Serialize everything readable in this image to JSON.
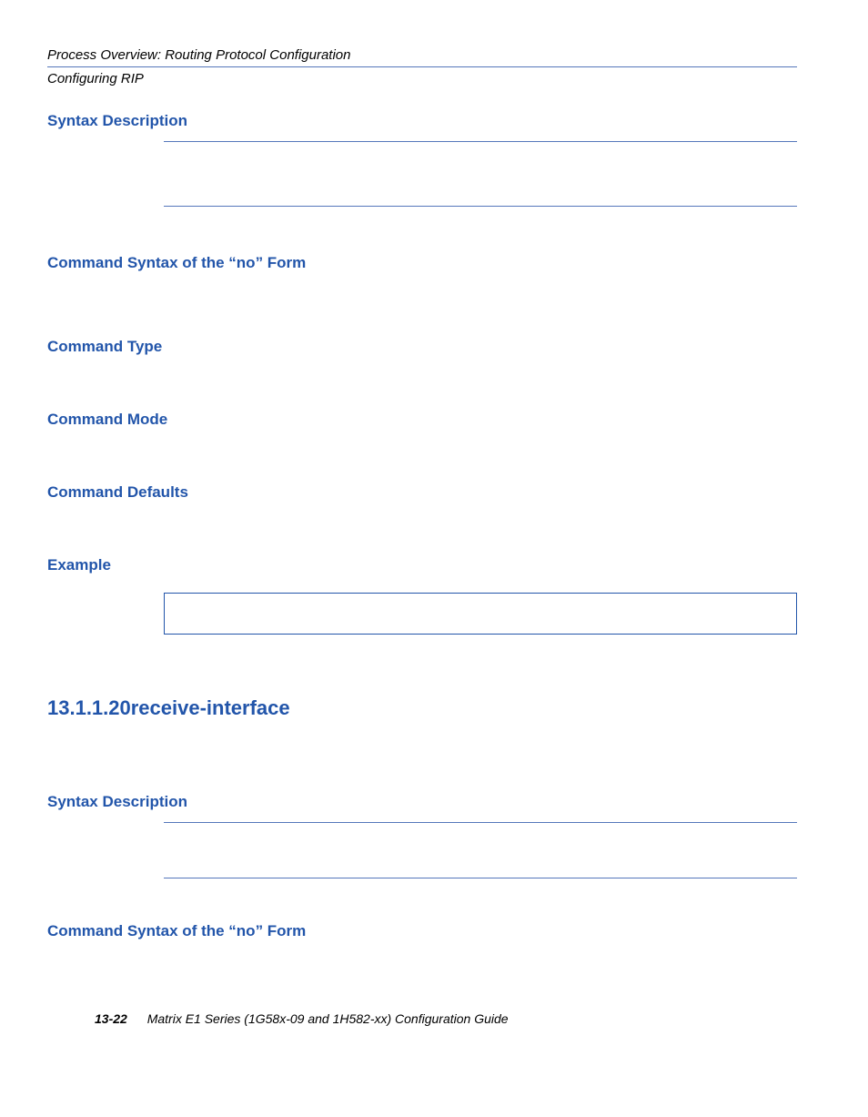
{
  "header": {
    "title": "Process Overview: Routing Protocol Configuration",
    "subtitle": "Configuring RIP"
  },
  "sections": {
    "syntax_description_1": "Syntax Description",
    "no_form_1": "Command Syntax of the “no” Form",
    "command_type": "Command Type",
    "command_mode": "Command Mode",
    "command_defaults": "Command Defaults",
    "example": "Example",
    "receive_interface_heading": "13.1.1.20receive-interface",
    "syntax_description_2": "Syntax Description",
    "no_form_2": "Command Syntax of the “no” Form"
  },
  "footer": {
    "page": "13-22",
    "text": "Matrix E1 Series (1G58x-09 and 1H582-xx) Configuration Guide"
  }
}
